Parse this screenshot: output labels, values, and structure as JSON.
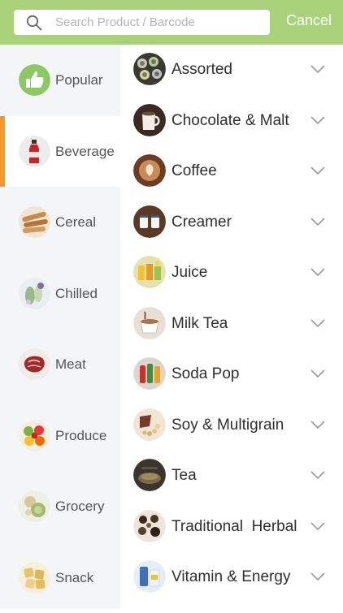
{
  "search": {
    "placeholder": "Search Product / Barcode",
    "value": ""
  },
  "header": {
    "cancel_label": "Cancel",
    "bg_color": "#a9d27a",
    "accent_color": "#f39a2e"
  },
  "sidebar": {
    "active": "Beverage",
    "items": [
      {
        "label": "Popular",
        "icon": "thumbs-up-icon"
      },
      {
        "label": "Beverage",
        "icon": "juice-bottle-thumbnail"
      },
      {
        "label": "Cereal",
        "icon": "cereal-thumbnail"
      },
      {
        "label": "Chilled",
        "icon": "chilled-thumbnail"
      },
      {
        "label": "Meat",
        "icon": "meat-thumbnail"
      },
      {
        "label": "Produce",
        "icon": "produce-thumbnail"
      },
      {
        "label": "Grocery",
        "icon": "grocery-thumbnail"
      },
      {
        "label": "Snack",
        "icon": "snack-thumbnail"
      }
    ]
  },
  "subcategories": [
    {
      "label": "Assorted",
      "icon": "assorted-cans-thumbnail"
    },
    {
      "label": "Chocolate & Malt",
      "icon": "chocolate-mug-thumbnail"
    },
    {
      "label": "Coffee",
      "icon": "coffee-cup-thumbnail"
    },
    {
      "label": "Creamer",
      "icon": "creamer-thumbnail"
    },
    {
      "label": "Juice",
      "icon": "juice-glasses-thumbnail"
    },
    {
      "label": "Milk Tea",
      "icon": "milk-tea-thumbnail"
    },
    {
      "label": "Soda Pop",
      "icon": "soda-bottles-thumbnail"
    },
    {
      "label": "Soy & Multigrain",
      "icon": "soy-thumbnail"
    },
    {
      "label": "Tea",
      "icon": "tea-thumbnail"
    },
    {
      "label": "Traditional  Herbal",
      "icon": "herbal-thumbnail"
    },
    {
      "label": "Vitamin & Energy",
      "icon": "vitamin-drink-thumbnail"
    }
  ]
}
